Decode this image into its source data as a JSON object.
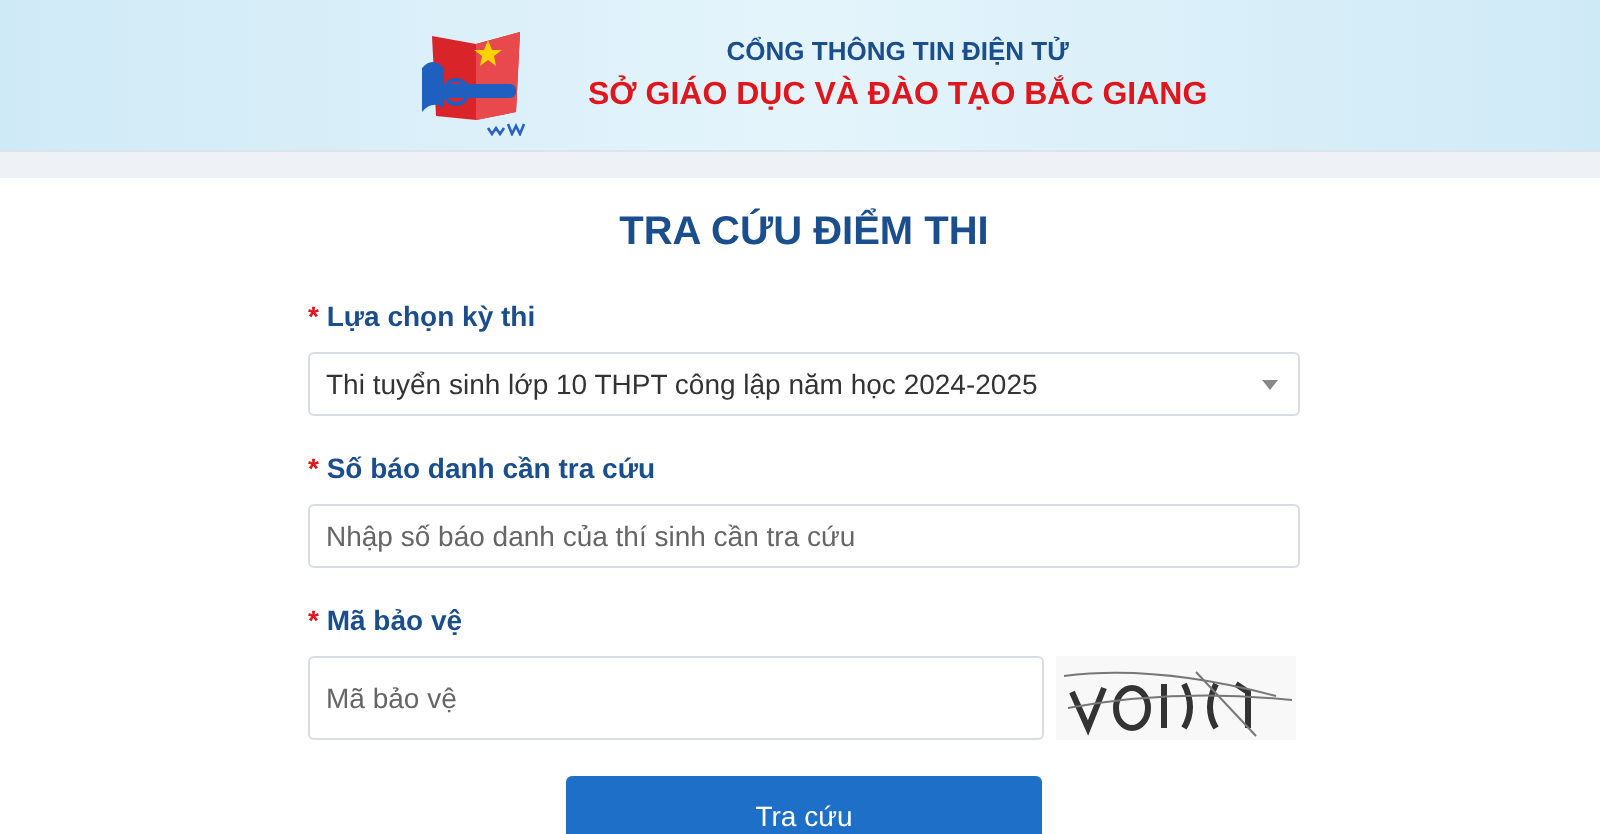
{
  "header": {
    "subtitle": "CỔNG THÔNG TIN ĐIỆN TỬ",
    "title": "SỞ GIÁO DỤC VÀ ĐÀO TẠO BẮC GIANG"
  },
  "page_title": "TRA CỨU ĐIỂM THI",
  "fields": [
    {
      "kind": "select",
      "required_mark": "*",
      "label": "Lựa chọn kỳ thi",
      "value": "Thi tuyển sinh lớp 10 THPT công lập năm học 2024-2025"
    },
    {
      "kind": "input",
      "required_mark": "*",
      "label": "Số báo danh cần tra cứu",
      "placeholder": "Nhập số báo danh của thí sinh cần tra cứu"
    },
    {
      "kind": "captcha",
      "required_mark": "*",
      "label": "Mã bảo vệ",
      "placeholder": "Mã bảo vệ"
    }
  ],
  "submit_button": "Tra cứu"
}
